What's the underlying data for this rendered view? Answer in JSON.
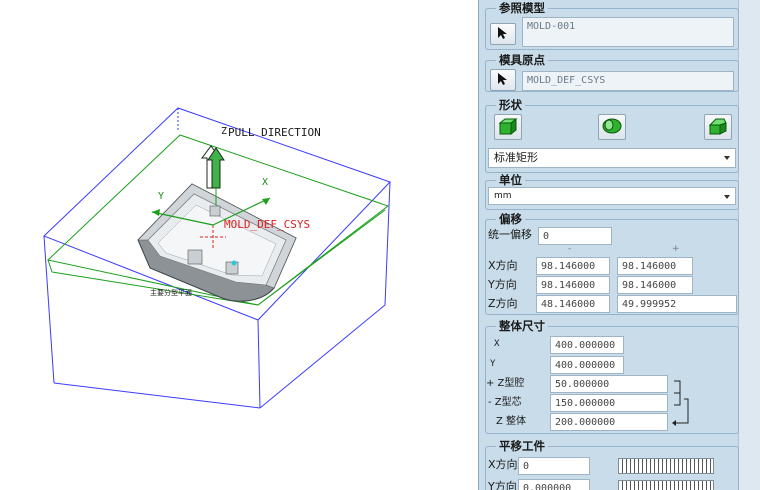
{
  "viewport": {
    "pull_direction_label": "PULL DIRECTION",
    "csys_label": "MOLD_DEF_CSYS",
    "axis_z": "Z",
    "axis_y": "Y",
    "axis_x": "X",
    "parting_label": "主要分型平面"
  },
  "panel": {
    "ref_model": {
      "title": "参照模型",
      "value": "MOLD-001",
      "select_icon": "cursor-arrow-icon"
    },
    "mold_origin": {
      "title": "模具原点",
      "value": "MOLD_DEF_CSYS",
      "select_icon": "cursor-arrow-icon"
    },
    "shape": {
      "title": "形状",
      "buttons": [
        "box-shape-icon",
        "cylinder-shape-icon",
        "custom-shape-icon"
      ],
      "selected": "标准矩形"
    },
    "units": {
      "title": "单位",
      "selected": "mm"
    },
    "offset": {
      "title": "偏移",
      "uniform_label": "统一偏移",
      "uniform_value": "0",
      "minus_header": "-",
      "plus_header": "+",
      "rows": [
        {
          "label": "X方向",
          "minus": "98.146000",
          "plus": "98.146000"
        },
        {
          "label": "Y方向",
          "minus": "98.146000",
          "plus": "98.146000"
        },
        {
          "label": "Z方向",
          "minus": "48.146000",
          "plus": "49.999952"
        }
      ]
    },
    "overall": {
      "title": "整体尺寸",
      "x_label": "X",
      "x_value": "400.000000",
      "y_label": "Y",
      "y_value": "400.000000",
      "z_cavity_label": "+ Z型腔",
      "z_cavity_value": "50.000000",
      "z_core_label": "- Z型芯",
      "z_core_value": "150.000000",
      "z_total_label": "Z 整体",
      "z_total_value": "200.000000"
    },
    "translate": {
      "title": "平移工件",
      "x_label": "X方向",
      "x_value": "0",
      "y_label": "Y方向",
      "y_value": "0.000000"
    }
  },
  "colors": {
    "panel_bg": "#c8dcea",
    "workpiece_edges": "#3b3bff",
    "parting_edges": "#1aa01a",
    "csys_red": "#e02020",
    "part_gray": "#8c9296"
  }
}
